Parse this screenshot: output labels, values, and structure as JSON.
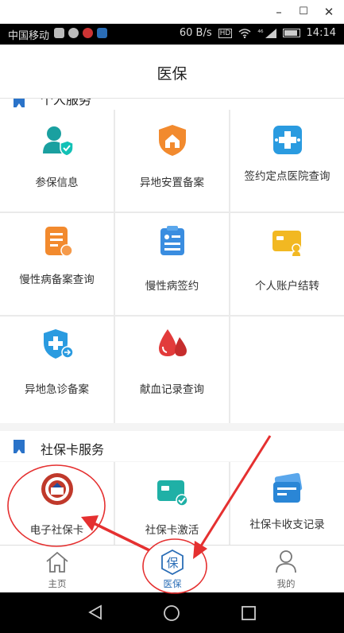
{
  "window": {
    "minimize": "–",
    "maximize": "☐",
    "close": "✕"
  },
  "status_bar": {
    "carrier": "中国移动",
    "speed": "60 B/s",
    "network": "⁴⁶",
    "time": "14:14"
  },
  "header": {
    "title": "医保"
  },
  "personal_section": {
    "title": "个人服务",
    "items": [
      {
        "label": "参保信息",
        "icon": "user-shield-icon",
        "color": "#1aa0a0"
      },
      {
        "label": "异地安置备案",
        "icon": "house-shield-icon",
        "color": "#f28a2e"
      },
      {
        "label": "签约定点医院查询",
        "icon": "hospital-cross-icon",
        "color": "#2a9be0"
      },
      {
        "label": "慢性病备案查询",
        "icon": "document-icon",
        "color": "#f28a2e"
      },
      {
        "label": "慢性病签约",
        "icon": "clipboard-icon",
        "color": "#3a8de0"
      },
      {
        "label": "个人账户结转",
        "icon": "card-icon",
        "color": "#f2b822"
      },
      {
        "label": "异地急诊备案",
        "icon": "emergency-shield-icon",
        "color": "#2a9be0"
      },
      {
        "label": "献血记录查询",
        "icon": "blood-drop-icon",
        "color": "#e23b3b"
      }
    ]
  },
  "card_section": {
    "title": "社保卡服务",
    "items": [
      {
        "label": "电子社保卡",
        "icon": "social-security-emblem-icon",
        "color": "#c0392b"
      },
      {
        "label": "社保卡激活",
        "icon": "card-check-icon",
        "color": "#1fb0a6"
      },
      {
        "label": "社保卡收支记录",
        "icon": "wallet-card-icon",
        "color": "#2a86d6"
      }
    ]
  },
  "bottom_nav": {
    "items": [
      {
        "label": "主页",
        "icon": "home-icon"
      },
      {
        "label": "医保",
        "icon": "insurance-bao-icon",
        "glyph": "保"
      },
      {
        "label": "我的",
        "icon": "person-icon"
      }
    ],
    "active": "医保",
    "active_color": "#2a6db6"
  },
  "annotation_color": "#e53030"
}
